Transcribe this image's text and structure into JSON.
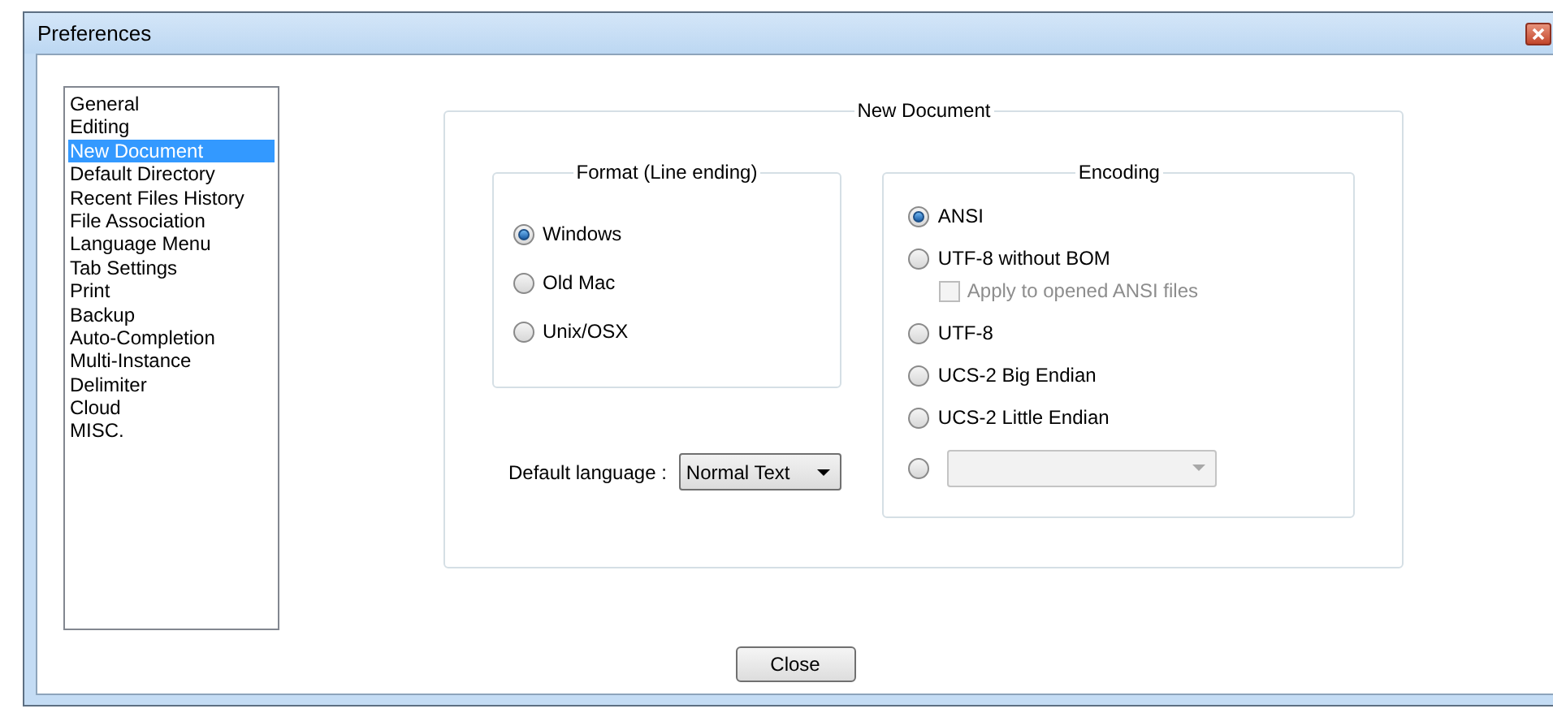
{
  "window": {
    "title": "Preferences"
  },
  "sidebar": {
    "items": [
      {
        "label": "General",
        "selected": false
      },
      {
        "label": "Editing",
        "selected": false
      },
      {
        "label": "New Document",
        "selected": true
      },
      {
        "label": "Default Directory",
        "selected": false
      },
      {
        "label": "Recent Files History",
        "selected": false
      },
      {
        "label": "File Association",
        "selected": false
      },
      {
        "label": "Language Menu",
        "selected": false
      },
      {
        "label": "Tab Settings",
        "selected": false
      },
      {
        "label": "Print",
        "selected": false
      },
      {
        "label": "Backup",
        "selected": false
      },
      {
        "label": "Auto-Completion",
        "selected": false
      },
      {
        "label": "Multi-Instance",
        "selected": false
      },
      {
        "label": "Delimiter",
        "selected": false
      },
      {
        "label": "Cloud",
        "selected": false
      },
      {
        "label": "MISC.",
        "selected": false
      }
    ]
  },
  "new_document": {
    "title": "New Document",
    "format": {
      "title": "Format (Line ending)",
      "options": [
        {
          "label": "Windows",
          "selected": true
        },
        {
          "label": "Old Mac",
          "selected": false
        },
        {
          "label": "Unix/OSX",
          "selected": false
        }
      ]
    },
    "default_language": {
      "label": "Default language :",
      "value": "Normal Text"
    },
    "encoding": {
      "title": "Encoding",
      "options": [
        {
          "kind": "radio",
          "label": "ANSI",
          "selected": true
        },
        {
          "kind": "radio",
          "label": "UTF-8 without BOM",
          "selected": false
        },
        {
          "kind": "checkbox",
          "label": "Apply to opened ANSI files",
          "checked": false,
          "disabled": true
        },
        {
          "kind": "radio",
          "label": "UTF-8",
          "selected": false
        },
        {
          "kind": "radio",
          "label": "UCS-2 Big Endian",
          "selected": false
        },
        {
          "kind": "radio",
          "label": "UCS-2 Little Endian",
          "selected": false
        },
        {
          "kind": "radio-combo",
          "selected": false,
          "disabled": true
        }
      ]
    }
  },
  "buttons": [
    {
      "label": "Close"
    }
  ]
}
